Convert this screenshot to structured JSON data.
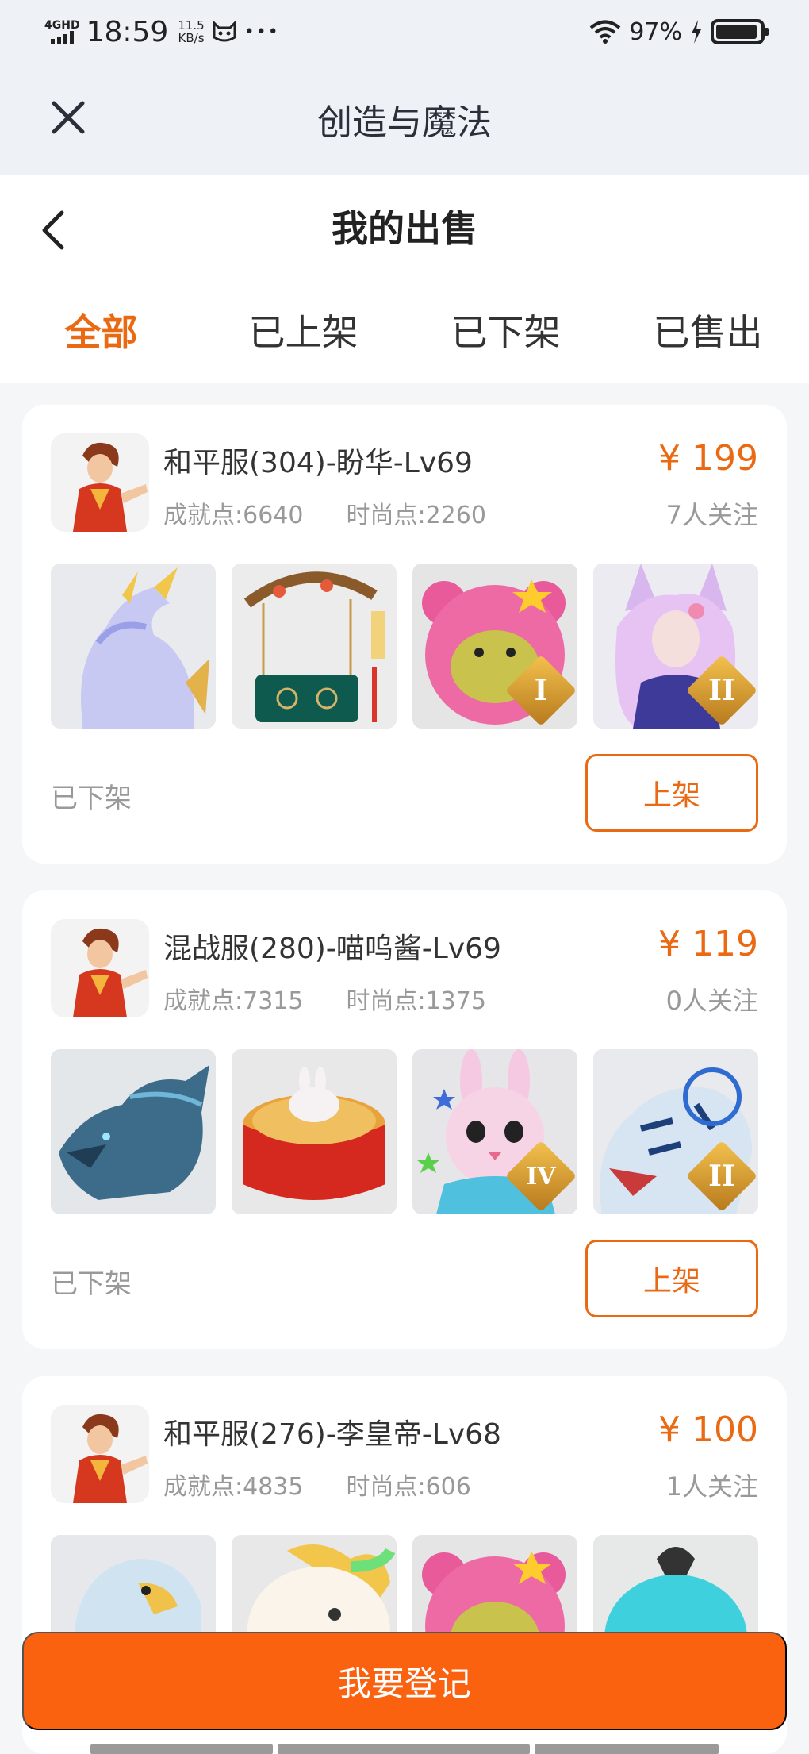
{
  "status_bar": {
    "network": "4GHD",
    "time": "18:59",
    "speed_value": "11.5",
    "speed_unit": "KB/s",
    "more": "•••",
    "battery": "97%"
  },
  "app_header": {
    "title": "创造与魔法"
  },
  "page": {
    "title": "我的出售"
  },
  "tabs": [
    {
      "label": "全部"
    },
    {
      "label": "已上架"
    },
    {
      "label": "已下架"
    },
    {
      "label": "已售出"
    }
  ],
  "listings": [
    {
      "server": "和平服(304)-盼华-Lv69",
      "achievement": "成就点:6640",
      "fashion": "时尚点:2260",
      "price": "¥ 199",
      "watchers": "7人关注",
      "thumbs": [
        {
          "icon": "ice-horse-mount-icon",
          "tier": ""
        },
        {
          "icon": "swing-furniture-icon",
          "tier": ""
        },
        {
          "icon": "pink-bear-pet-icon",
          "tier": "I"
        },
        {
          "icon": "fox-fairy-outfit-icon",
          "tier": "II"
        }
      ],
      "state": "已下架",
      "action": "上架"
    },
    {
      "server": "混战服(280)-喵呜酱-Lv69",
      "achievement": "成就点:7315",
      "fashion": "时尚点:1375",
      "price": "¥ 119",
      "watchers": "0人关注",
      "thumbs": [
        {
          "icon": "blue-dragon-mount-icon",
          "tier": ""
        },
        {
          "icon": "red-drum-bed-icon",
          "tier": ""
        },
        {
          "icon": "bunny-pet-icon",
          "tier": "IV"
        },
        {
          "icon": "white-tiger-mount-icon",
          "tier": "II"
        }
      ],
      "state": "已下架",
      "action": "上架"
    },
    {
      "server": "和平服(276)-李皇帝-Lv68",
      "achievement": "成就点:4835",
      "fashion": "时尚点:606",
      "price": "¥ 100",
      "watchers": "1人关注",
      "thumbs": [
        {
          "icon": "eagle-mount-icon",
          "tier": ""
        },
        {
          "icon": "unicorn-pet-icon",
          "tier": ""
        },
        {
          "icon": "pink-bear-pet-icon",
          "tier": ""
        },
        {
          "icon": "teal-fruit-pet-icon",
          "tier": ""
        }
      ]
    }
  ],
  "footer": {
    "register_label": "我要登记"
  },
  "colors": {
    "accent": "#ea6a13",
    "register_button": "#fa620f",
    "header_bg": "#eef1f6"
  }
}
